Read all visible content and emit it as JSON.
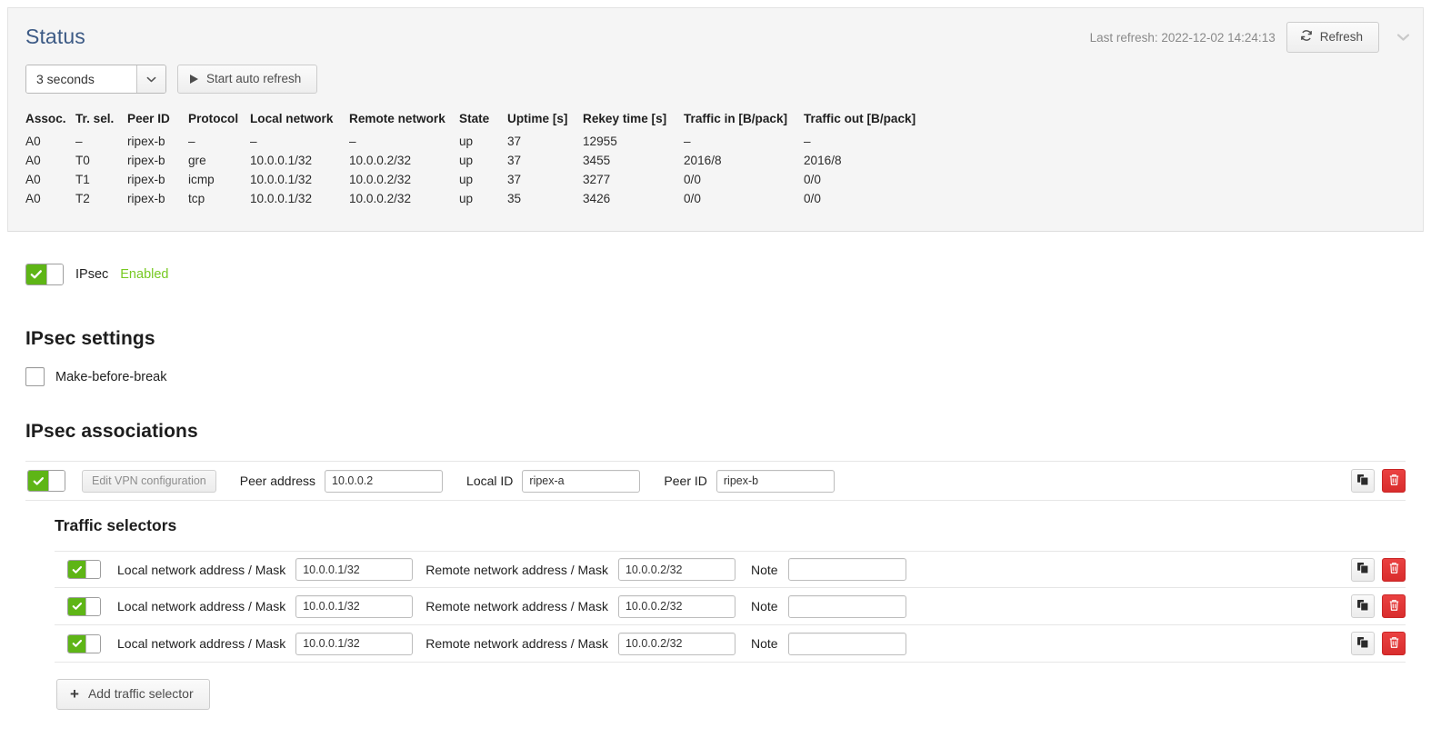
{
  "status_panel": {
    "title": "Status",
    "last_refresh_label": "Last refresh: 2022-12-02 14:24:13",
    "refresh_button": "Refresh",
    "refresh_icon": "refresh-circular-arrows-icon",
    "collapse_icon": "chevron-down-icon",
    "interval_select": {
      "value": "3 seconds",
      "arrow_icon": "chevron-down-icon"
    },
    "auto_refresh_button": {
      "label": "Start auto refresh",
      "icon": "play-triangle-icon"
    },
    "table": {
      "headers": [
        "Assoc.",
        "Tr. sel.",
        "Peer ID",
        "Protocol",
        "Local network",
        "Remote network",
        "State",
        "Uptime [s]",
        "Rekey time [s]",
        "Traffic in [B/pack]",
        "Traffic out [B/pack]"
      ],
      "rows": [
        [
          "A0",
          "–",
          "ripex-b",
          "–",
          "–",
          "–",
          "up",
          "37",
          "12955",
          "–",
          "–"
        ],
        [
          "A0",
          "T0",
          "ripex-b",
          "gre",
          "10.0.0.1/32",
          "10.0.0.2/32",
          "up",
          "37",
          "3455",
          "2016/8",
          "2016/8"
        ],
        [
          "A0",
          "T1",
          "ripex-b",
          "icmp",
          "10.0.0.1/32",
          "10.0.0.2/32",
          "up",
          "37",
          "3277",
          "0/0",
          "0/0"
        ],
        [
          "A0",
          "T2",
          "ripex-b",
          "tcp",
          "10.0.0.1/32",
          "10.0.0.2/32",
          "up",
          "35",
          "3426",
          "0/0",
          "0/0"
        ]
      ]
    }
  },
  "ipsec": {
    "toggle_state": "on",
    "label": "IPsec",
    "status_text": "Enabled",
    "status_color": "#77c922",
    "toggle_color": "#5eb516"
  },
  "settings": {
    "heading": "IPsec settings",
    "make_before_break": {
      "label": "Make-before-break",
      "checked": false
    }
  },
  "associations": {
    "heading": "IPsec associations",
    "row": {
      "enabled": true,
      "edit_vpn_button": "Edit VPN configuration",
      "peer_address_label": "Peer address",
      "peer_address_value": "10.0.0.2",
      "local_id_label": "Local ID",
      "local_id_value": "ripex-a",
      "peer_id_label": "Peer ID",
      "peer_id_value": "ripex-b",
      "copy_icon": "copy-duplicate-icon",
      "delete_icon": "trash-delete-icon"
    },
    "traffic_selectors": {
      "heading": "Traffic selectors",
      "local_label": "Local network address / Mask",
      "remote_label": "Remote network address / Mask",
      "note_label": "Note",
      "copy_icon": "copy-duplicate-icon",
      "delete_icon": "trash-delete-icon",
      "rows": [
        {
          "enabled": true,
          "local": "10.0.0.1/32",
          "remote": "10.0.0.2/32",
          "note": ""
        },
        {
          "enabled": true,
          "local": "10.0.0.1/32",
          "remote": "10.0.0.2/32",
          "note": ""
        },
        {
          "enabled": true,
          "local": "10.0.0.1/32",
          "remote": "10.0.0.2/32",
          "note": ""
        }
      ],
      "add_button": {
        "label": "Add traffic selector",
        "icon": "plus-icon"
      }
    }
  }
}
